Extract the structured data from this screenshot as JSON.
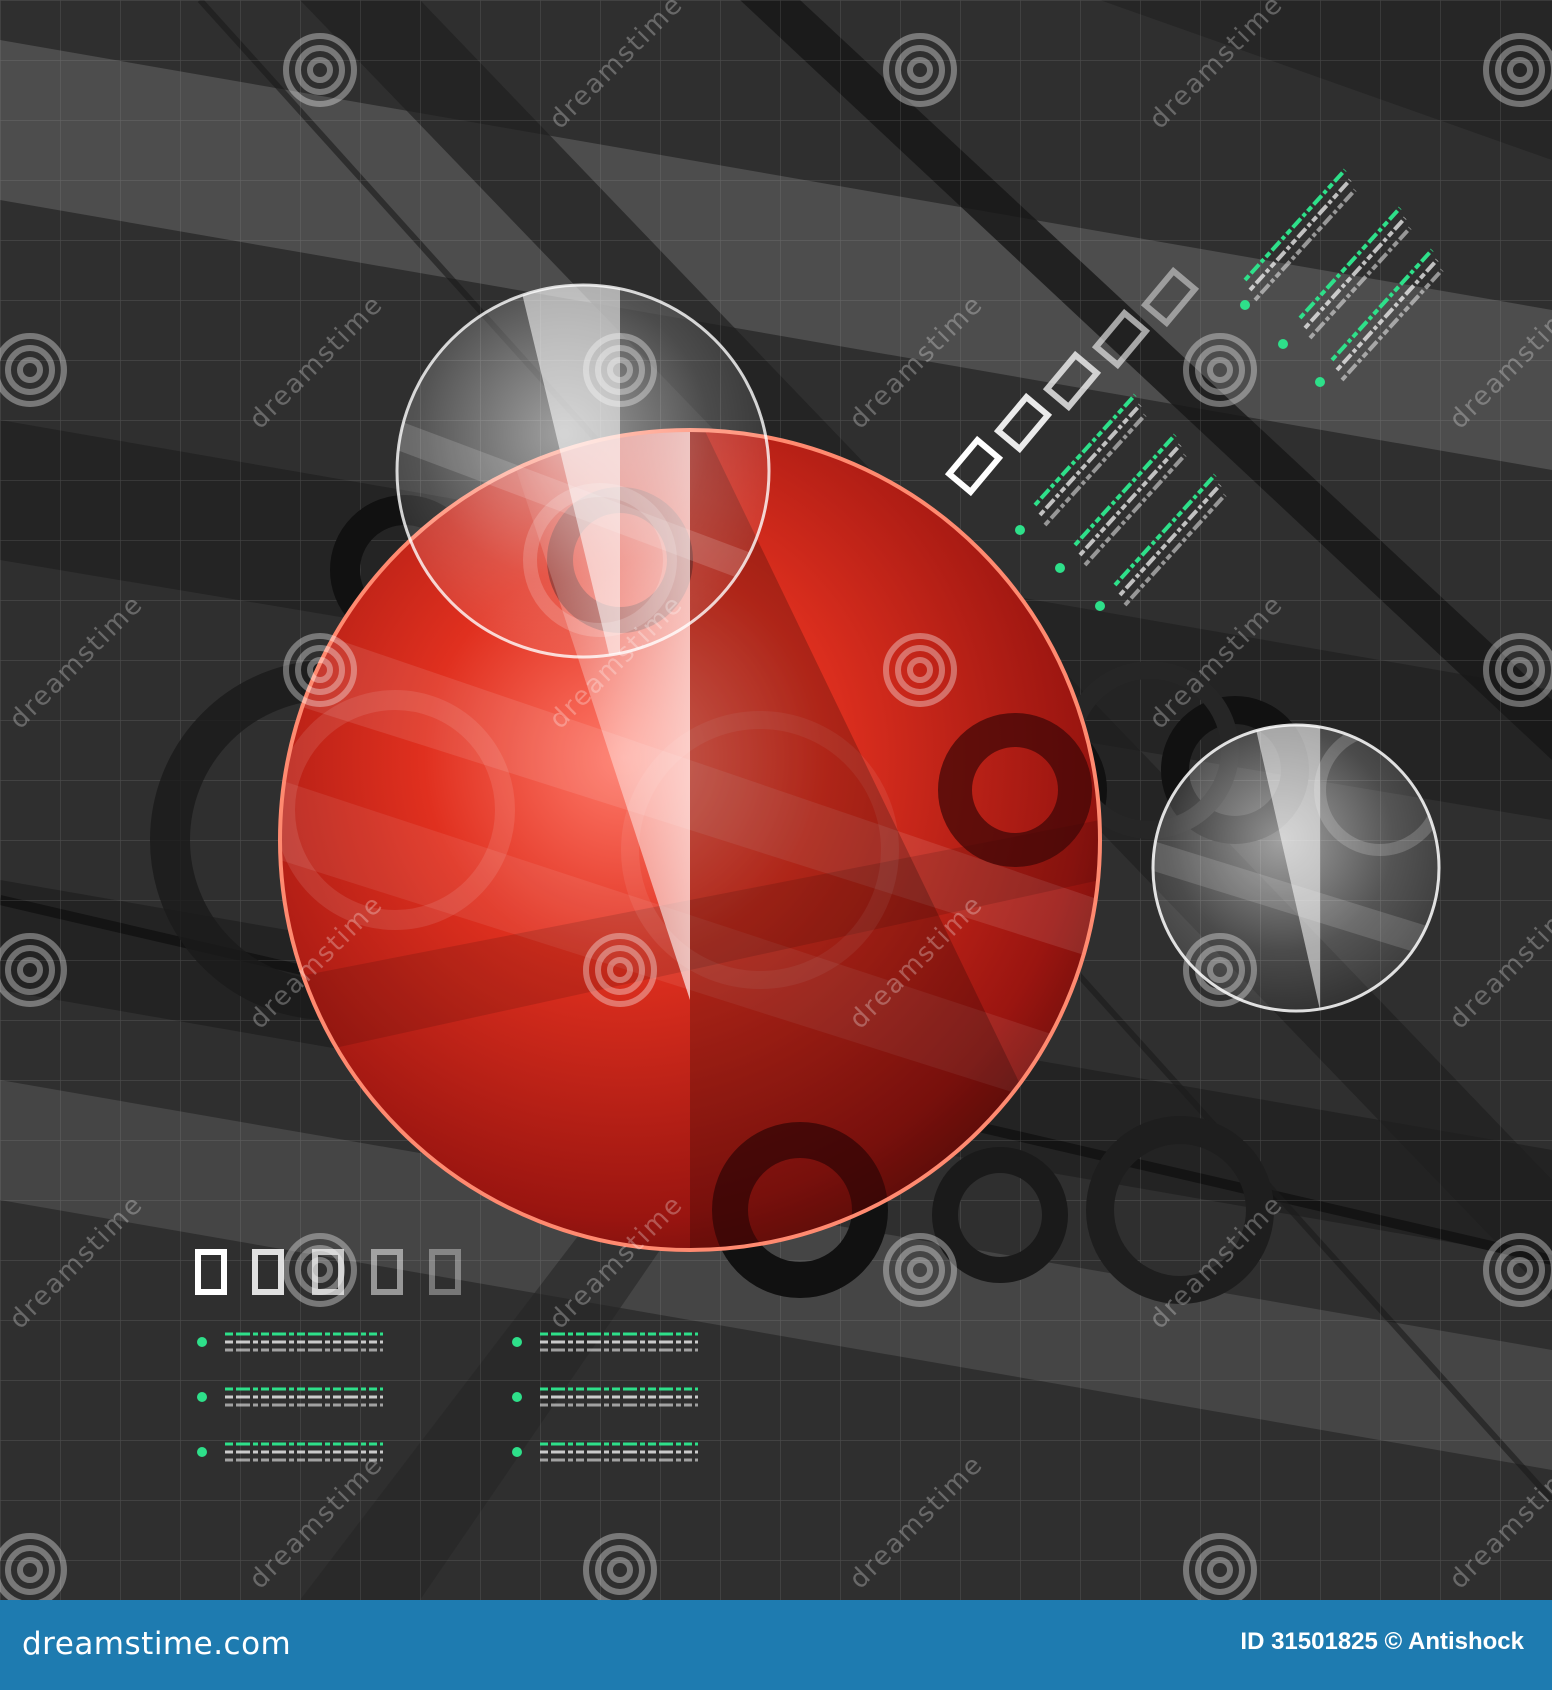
{
  "watermark": {
    "text": "dreamstime",
    "icon": "spiral-logo-icon"
  },
  "footer": {
    "site": "dreamstime.com",
    "credit": "ID 31501825 © Antishock"
  },
  "colors": {
    "background": "#2f2f2f",
    "footer": "#1e7bb0",
    "accent_red": "#d0221a",
    "accent_green": "#2ee08a",
    "glass": "#ffffff"
  }
}
